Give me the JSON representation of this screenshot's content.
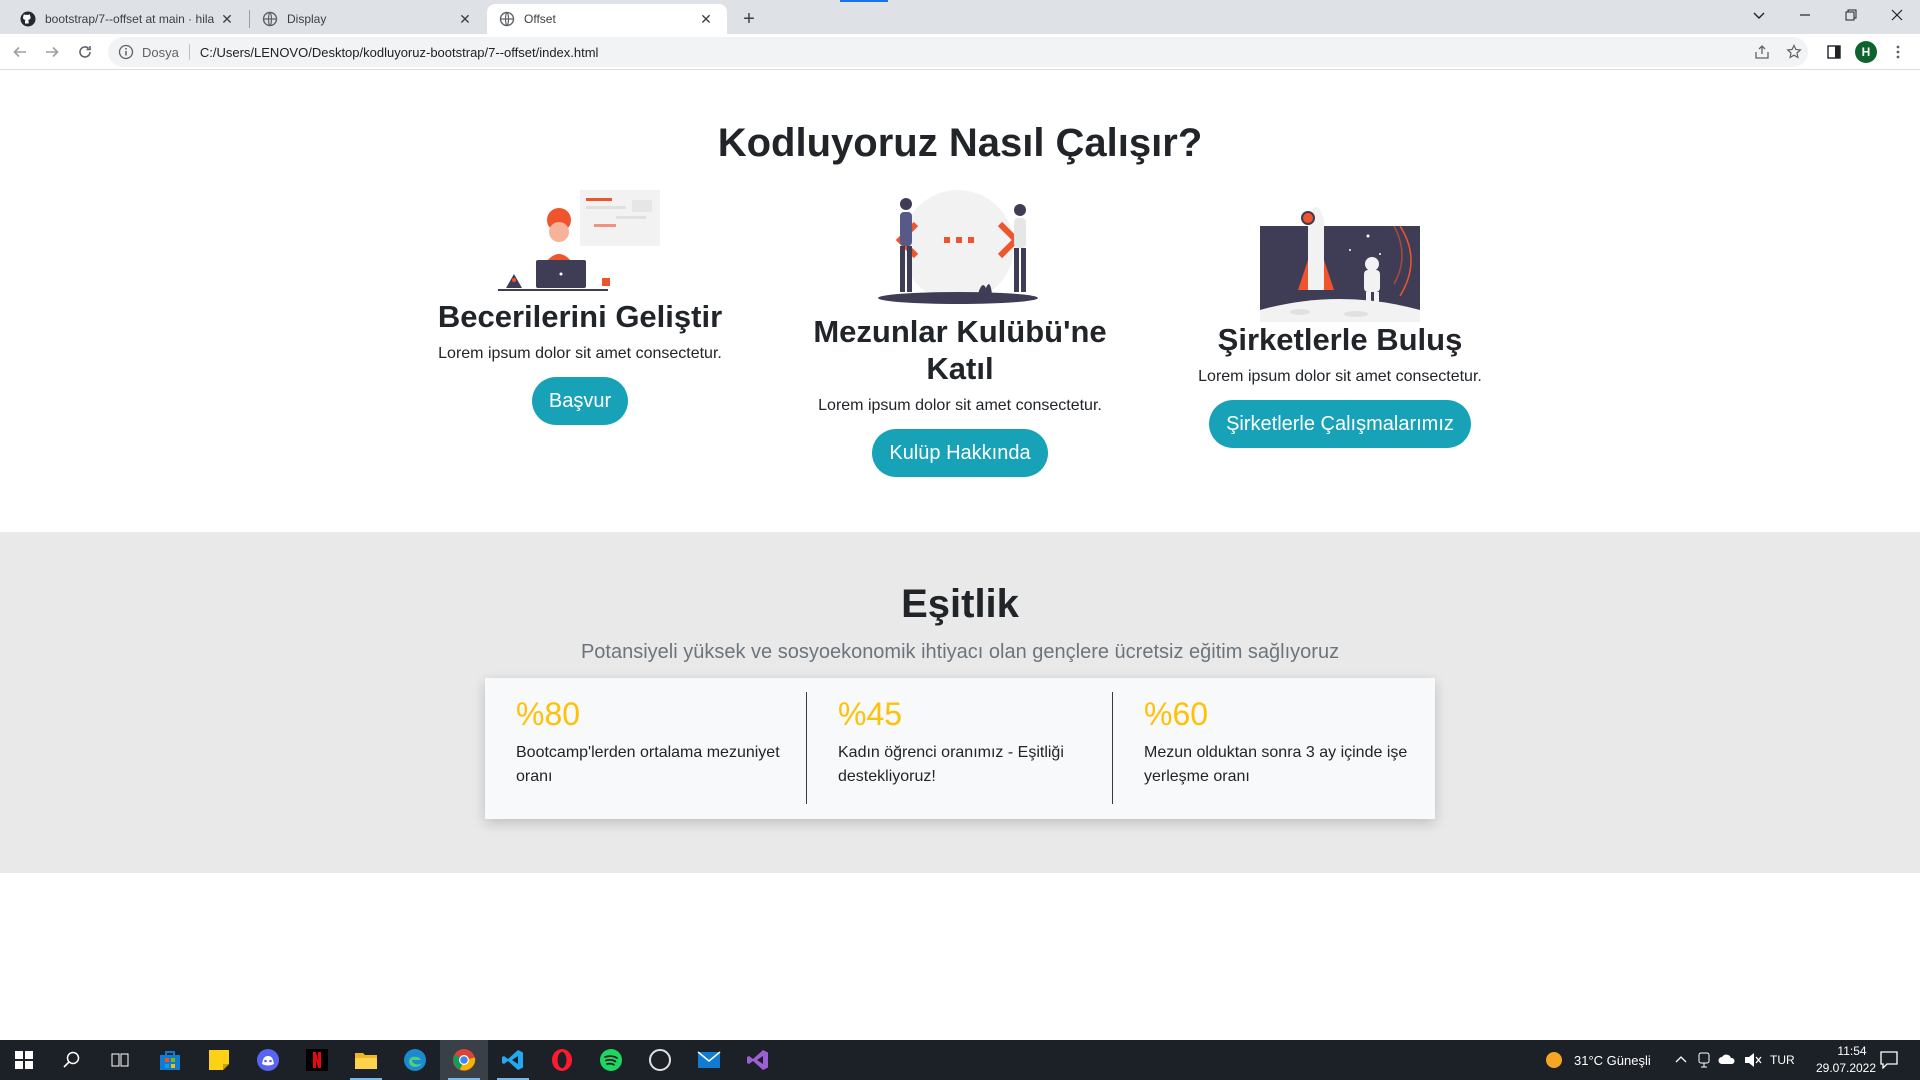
{
  "browser": {
    "tabs": [
      {
        "title": "bootstrap/7--offset at main · hila",
        "icon": "github-icon",
        "active": false
      },
      {
        "title": "Display",
        "icon": "globe-icon",
        "active": false
      },
      {
        "title": "Offset",
        "icon": "globe-icon",
        "active": true
      }
    ],
    "close_glyph": "✕",
    "new_tab_glyph": "+",
    "address": {
      "scheme_label": "Dosya",
      "url": "C:/Users/LENOVO/Desktop/kodluyoruz-bootstrap/7--offset/index.html"
    },
    "profile_initial": "H"
  },
  "page": {
    "how_title": "Kodluyoruz Nasıl Çalışır?",
    "cards": [
      {
        "title": "Becerilerini Geliştir",
        "text": "Lorem ipsum dolor sit amet consectetur.",
        "button": "Başvur"
      },
      {
        "title": "Mezunlar Kulübü'ne Katıl",
        "text": "Lorem ipsum dolor sit amet consectetur.",
        "button": "Kulüp Hakkında"
      },
      {
        "title": "Şirketlerle Buluş",
        "text": "Lorem ipsum dolor sit amet consectetur.",
        "button": "Şirketlerle Çalışmalarımız"
      }
    ],
    "equality": {
      "title": "Eşitlik",
      "subtitle": "Potansiyeli yüksek ve sosyoekonomik ihtiyacı olan gençlere ücretsiz eğitim sağlıyoruz",
      "stats": [
        {
          "value": "%80",
          "desc": "Bootcamp'lerden ortalama mezuniyet oranı"
        },
        {
          "value": "%45",
          "desc": "Kadın öğrenci oranımız - Eşitliği destekliyoruz!"
        },
        {
          "value": "%60",
          "desc": "Mezun olduktan sonra 3 ay içinde işe yerleşme oranı"
        }
      ]
    }
  },
  "colors": {
    "accent_button": "#17a2b8",
    "stat_number": "#ffc107",
    "illustration_orange": "#f0542d",
    "illustration_dark": "#3f3d56"
  },
  "taskbar": {
    "apps": [
      "windows-start-icon",
      "search-icon",
      "task-view-icon",
      "microsoft-store-icon",
      "sticky-notes-icon",
      "discord-icon",
      "netflix-icon",
      "file-explorer-icon",
      "edge-icon",
      "chrome-icon",
      "vscode-icon",
      "opera-icon",
      "spotify-icon",
      "circle-app-icon",
      "mail-icon",
      "visual-studio-icon"
    ],
    "weather": "31°C  Güneşli",
    "language": "TUR",
    "time": "11:54",
    "date": "29.07.2022"
  }
}
